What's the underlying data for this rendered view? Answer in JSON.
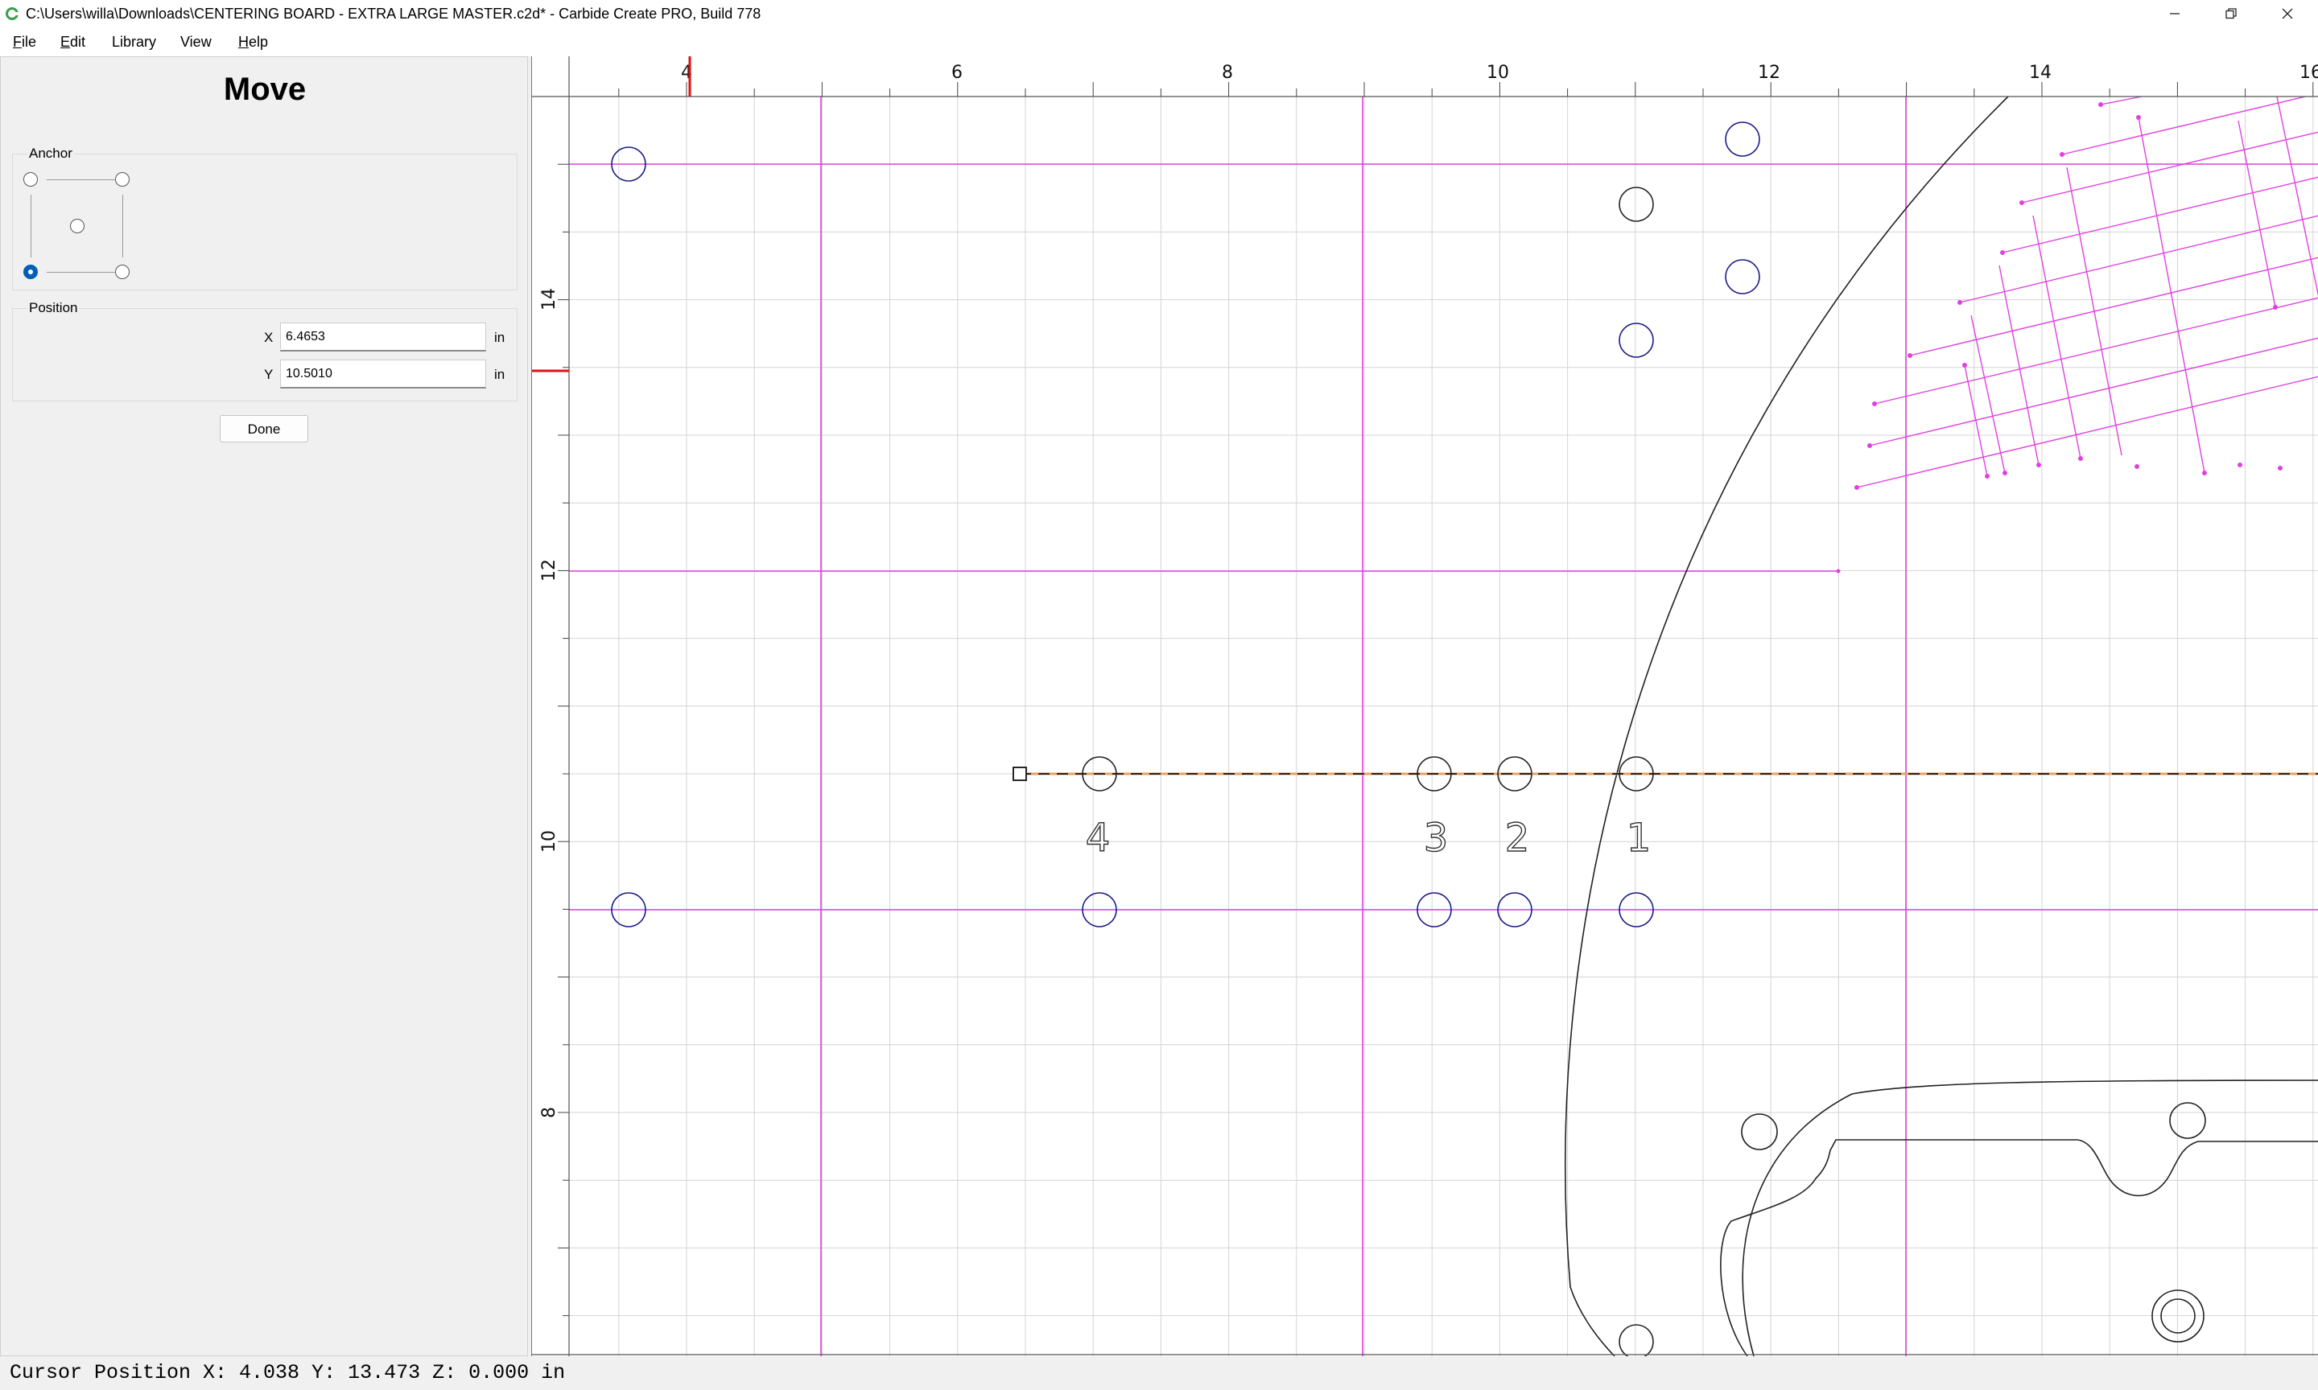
{
  "window": {
    "title": "C:\\Users\\willa\\Downloads\\CENTERING BOARD - EXTRA LARGE MASTER.c2d* - Carbide Create PRO, Build 778",
    "app_icon": "carbide-c-icon",
    "controls": [
      "minimize-icon",
      "restore-icon",
      "close-icon"
    ]
  },
  "menu": {
    "file": {
      "label": "File",
      "mnemonic": "F",
      "rest": "ile"
    },
    "edit": {
      "label": "Edit",
      "mnemonic": "E",
      "rest": "dit"
    },
    "library": {
      "label": "Library",
      "mnemonic": "",
      "rest": "Library"
    },
    "view": {
      "label": "View",
      "mnemonic": "",
      "rest": "View"
    },
    "help": {
      "label": "Help",
      "mnemonic": "H",
      "rest": "elp"
    }
  },
  "panel": {
    "title": "Move",
    "anchor": {
      "label": "Anchor",
      "options": [
        "top-left",
        "top-right",
        "center",
        "bottom-left",
        "bottom-right"
      ],
      "selected": "bottom-left"
    },
    "position": {
      "label": "Position",
      "x_label": "X",
      "x_value": "6.4653",
      "y_label": "Y",
      "y_value": "10.5010",
      "unit": "in"
    },
    "done_label": "Done"
  },
  "canvas": {
    "units": "in",
    "ruler_top_labels": [
      "4",
      "6",
      "8",
      "10",
      "12",
      "14",
      "16"
    ],
    "ruler_left_labels": [
      "14",
      "12",
      "10",
      "8"
    ],
    "cursor_marker": {
      "x": 4.038,
      "y": 13.473
    },
    "hole_labels": [
      "4",
      "3",
      "2",
      "1"
    ],
    "colors": {
      "guide": "#e040e0",
      "hole": "#1a1a8a",
      "outline": "#222222",
      "cursor": "#e01010",
      "toolpath": "#e8a060",
      "grid": "#d4d4d4"
    }
  },
  "status": {
    "cursor_position": "Cursor Position X: 4.038 Y: 13.473 Z: 0.000 in"
  }
}
